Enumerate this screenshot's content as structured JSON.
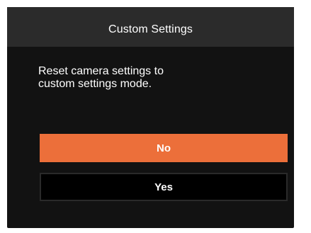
{
  "dialog": {
    "title": "Custom Settings",
    "message_lines": [
      "Reset camera settings to",
      "custom settings mode."
    ]
  },
  "buttons": {
    "no_label": "No",
    "yes_label": "Yes",
    "selected": "No"
  },
  "colors": {
    "dialog_background": "#121212",
    "header_background": "#2b2b2b",
    "highlight": "#ec6f3a",
    "text": "#ffffff"
  }
}
